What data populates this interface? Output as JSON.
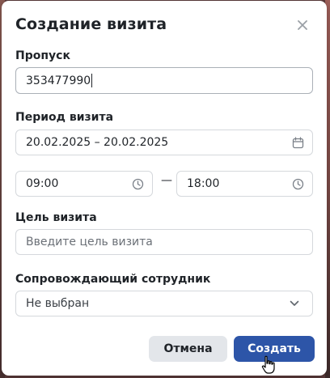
{
  "dialog": {
    "title": "Создание визита",
    "close_icon": "close-icon"
  },
  "pass": {
    "label": "Пропуск",
    "value": "353477990"
  },
  "period": {
    "label": "Период визита",
    "date_range": "20.02.2025 – 20.02.2025",
    "calendar_icon": "calendar-icon",
    "time_from": "09:00",
    "time_to": "18:00",
    "separator": "—",
    "clock_icon": "clock-icon"
  },
  "purpose": {
    "label": "Цель визита",
    "placeholder": "Введите цель визита"
  },
  "escort": {
    "label": "Сопровождающий сотрудник",
    "selected": "Не выбран",
    "chevron_icon": "chevron-down-icon"
  },
  "buttons": {
    "cancel": "Отмена",
    "create": "Создать"
  },
  "colors": {
    "primary": "#2d55a8",
    "secondary_bg": "#e3e6ea",
    "text": "#1f2328",
    "border": "#d5d8dc"
  }
}
